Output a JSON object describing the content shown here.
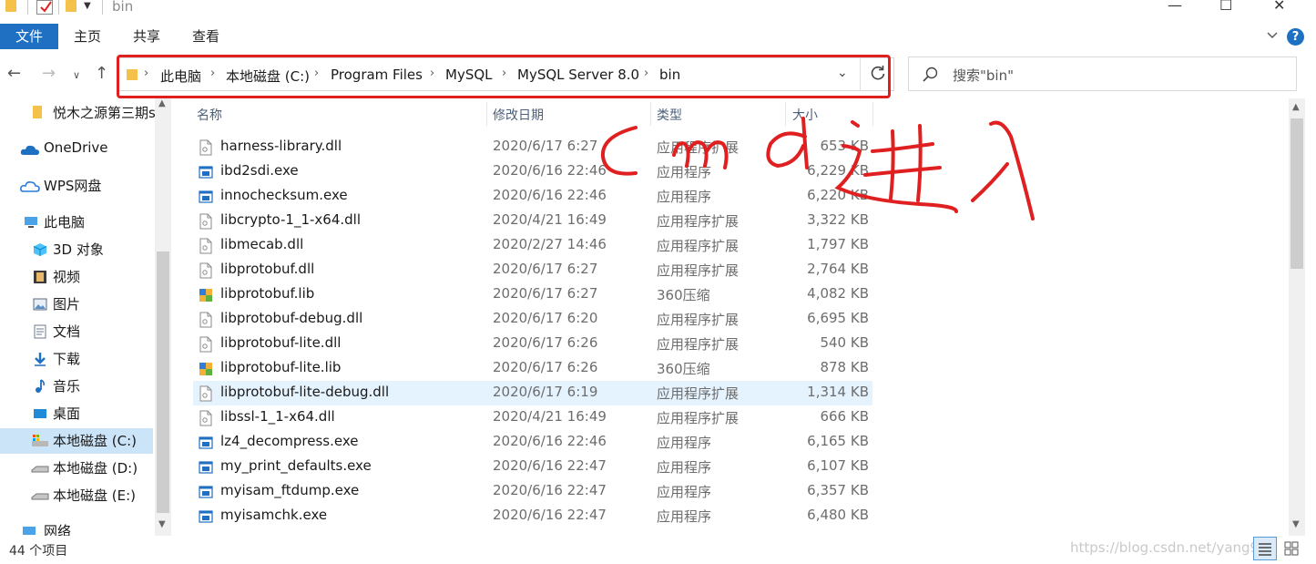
{
  "window": {
    "title": "bin",
    "minimize": "—",
    "maximize": "☐",
    "close": "✕"
  },
  "ribbon": {
    "file_tab": "文件",
    "tabs": [
      "主页",
      "共享",
      "查看"
    ],
    "help": "?"
  },
  "address_bar": {
    "breadcrumbs": [
      "此电脑",
      "本地磁盘 (C:)",
      "Program Files",
      "MySQL",
      "MySQL Server 8.0",
      "bin"
    ],
    "separator": "›"
  },
  "search": {
    "placeholder": "搜索\"bin\""
  },
  "sidebar": {
    "items": [
      {
        "label": "悦木之源第三期s",
        "icon": "folder-icon"
      },
      {
        "label": "OneDrive",
        "icon": "cloud-icon"
      },
      {
        "label": "WPS网盘",
        "icon": "cloud-icon"
      },
      {
        "label": "此电脑",
        "icon": "computer-icon"
      },
      {
        "label": "3D 对象",
        "icon": "cube-icon"
      },
      {
        "label": "视频",
        "icon": "video-icon"
      },
      {
        "label": "图片",
        "icon": "image-icon"
      },
      {
        "label": "文档",
        "icon": "document-icon"
      },
      {
        "label": "下载",
        "icon": "download-icon"
      },
      {
        "label": "音乐",
        "icon": "music-icon"
      },
      {
        "label": "桌面",
        "icon": "desktop-icon"
      },
      {
        "label": "本地磁盘 (C:)",
        "icon": "drive-icon",
        "selected": true
      },
      {
        "label": "本地磁盘 (D:)",
        "icon": "drive-icon"
      },
      {
        "label": "本地磁盘 (E:)",
        "icon": "drive-icon"
      },
      {
        "label": "网络",
        "icon": "network-icon"
      }
    ]
  },
  "columns": {
    "name": "名称",
    "modified": "修改日期",
    "type": "类型",
    "size": "大小"
  },
  "files": [
    {
      "name": "harness-library.dll",
      "date": "2020/6/17 6:27",
      "type": "应用程序扩展",
      "size": "653 KB",
      "icon": "dll-icon"
    },
    {
      "name": "ibd2sdi.exe",
      "date": "2020/6/16 22:46",
      "type": "应用程序",
      "size": "6,229 KB",
      "icon": "exe-icon"
    },
    {
      "name": "innochecksum.exe",
      "date": "2020/6/16 22:46",
      "type": "应用程序",
      "size": "6,220 KB",
      "icon": "exe-icon"
    },
    {
      "name": "libcrypto-1_1-x64.dll",
      "date": "2020/4/21 16:49",
      "type": "应用程序扩展",
      "size": "3,322 KB",
      "icon": "dll-icon"
    },
    {
      "name": "libmecab.dll",
      "date": "2020/2/27 14:46",
      "type": "应用程序扩展",
      "size": "1,797 KB",
      "icon": "dll-icon"
    },
    {
      "name": "libprotobuf.dll",
      "date": "2020/6/17 6:27",
      "type": "应用程序扩展",
      "size": "2,764 KB",
      "icon": "dll-icon"
    },
    {
      "name": "libprotobuf.lib",
      "date": "2020/6/17 6:27",
      "type": "360压缩",
      "size": "4,082 KB",
      "icon": "archive-icon"
    },
    {
      "name": "libprotobuf-debug.dll",
      "date": "2020/6/17 6:20",
      "type": "应用程序扩展",
      "size": "6,695 KB",
      "icon": "dll-icon"
    },
    {
      "name": "libprotobuf-lite.dll",
      "date": "2020/6/17 6:26",
      "type": "应用程序扩展",
      "size": "540 KB",
      "icon": "dll-icon"
    },
    {
      "name": "libprotobuf-lite.lib",
      "date": "2020/6/17 6:26",
      "type": "360压缩",
      "size": "878 KB",
      "icon": "archive-icon"
    },
    {
      "name": "libprotobuf-lite-debug.dll",
      "date": "2020/6/17 6:19",
      "type": "应用程序扩展",
      "size": "1,314 KB",
      "icon": "dll-icon",
      "hover": true
    },
    {
      "name": "libssl-1_1-x64.dll",
      "date": "2020/4/21 16:49",
      "type": "应用程序扩展",
      "size": "666 KB",
      "icon": "dll-icon"
    },
    {
      "name": "lz4_decompress.exe",
      "date": "2020/6/16 22:46",
      "type": "应用程序",
      "size": "6,165 KB",
      "icon": "exe-icon"
    },
    {
      "name": "my_print_defaults.exe",
      "date": "2020/6/16 22:47",
      "type": "应用程序",
      "size": "6,107 KB",
      "icon": "exe-icon"
    },
    {
      "name": "myisam_ftdump.exe",
      "date": "2020/6/16 22:47",
      "type": "应用程序",
      "size": "6,357 KB",
      "icon": "exe-icon"
    },
    {
      "name": "myisamchk.exe",
      "date": "2020/6/16 22:47",
      "type": "应用程序",
      "size": "6,480 KB",
      "icon": "exe-icon"
    }
  ],
  "status": {
    "item_count": "44 个项目"
  },
  "watermark": "https://blog.csdn.net/yang93",
  "colors": {
    "accent": "#1f6fc2",
    "annotation_red": "#e02020",
    "selection": "#cce4f7",
    "hover_row": "#e5f3ff"
  }
}
